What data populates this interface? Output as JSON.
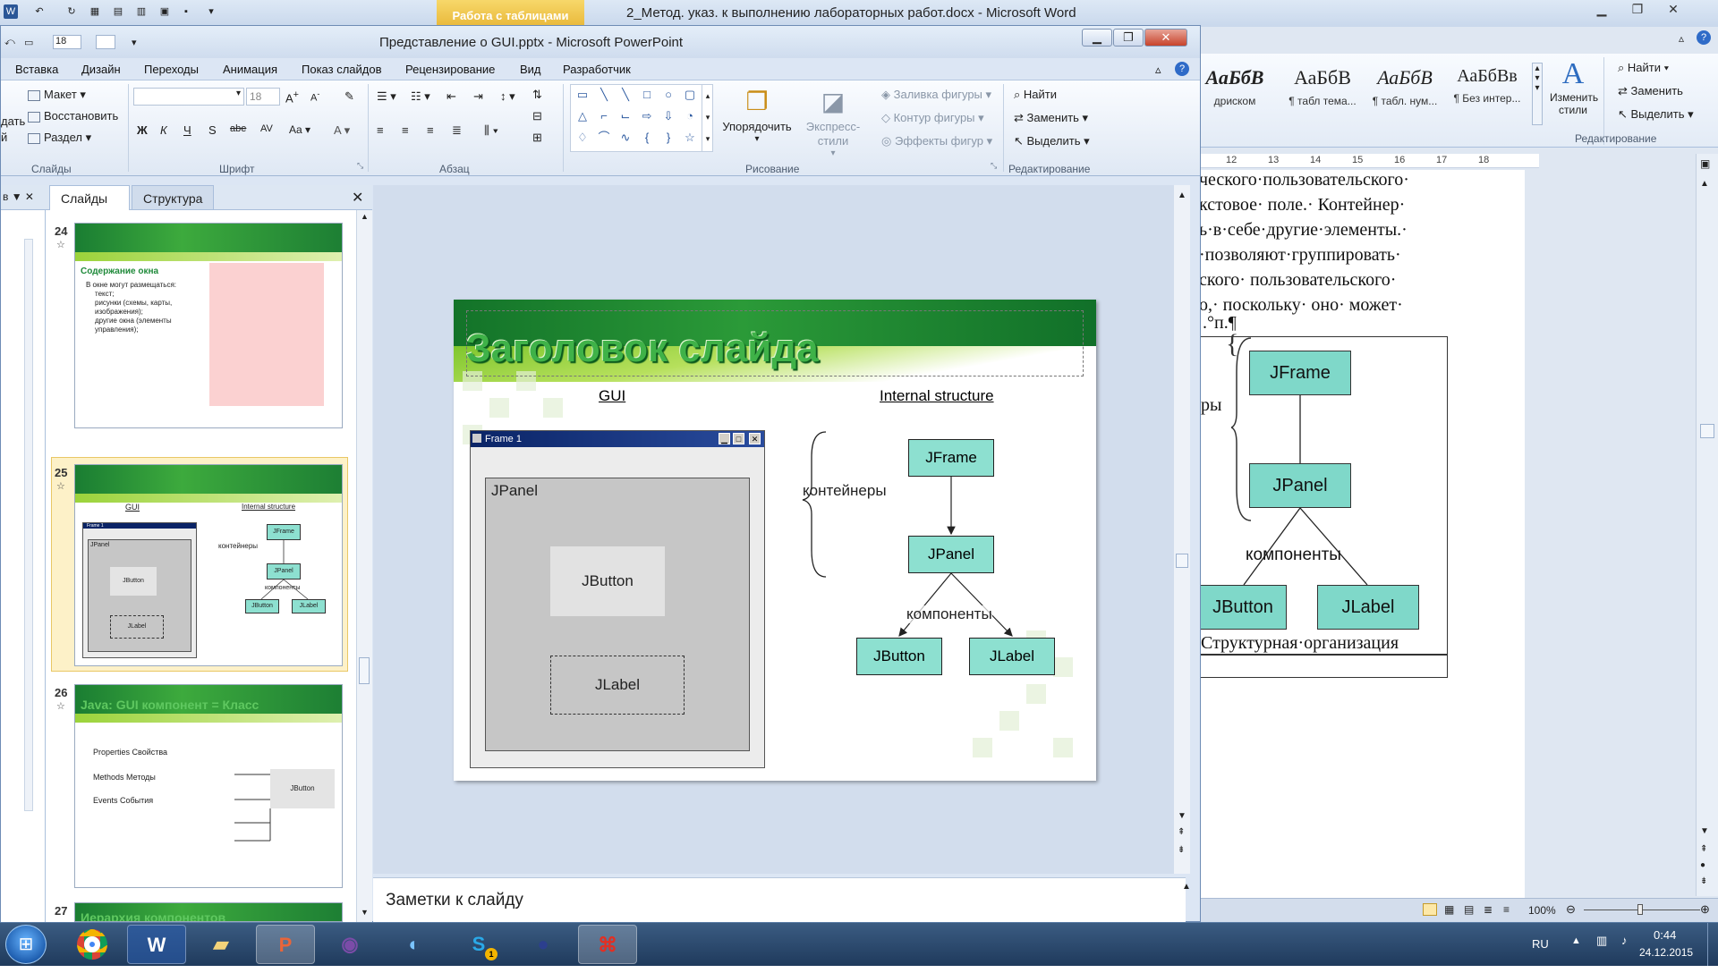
{
  "word": {
    "title": "2_Метод. указ. к выполнению лабораторных работ.docx - Microsoft Word",
    "context_tab": "Работа с таблицами",
    "styles": [
      {
        "sample": "АаБбВ",
        "name": "дриском"
      },
      {
        "sample": "АаБбВ",
        "name": "¶ табл тема..."
      },
      {
        "sample": "АаБбВ",
        "name": "¶ табл. нум..."
      },
      {
        "sample": "АаБбВв",
        "name": "¶ Без интер..."
      }
    ],
    "change_styles": "Изменить стили",
    "find": "Найти",
    "replace": "Заменить",
    "select": "Выделить",
    "editing_group": "Редактирование",
    "ruler": [
      "12",
      "13",
      "14",
      "15",
      "16",
      "17",
      "18"
    ],
    "doc_lines": [
      "ческого·пользовательского·",
      "кстовое· поле.· Контейнер·",
      "ь·в·себе·другие·элементы.·",
      "·позволяют·группировать·",
      "ского· пользовательского·",
      "о,· поскольку· оно· может·",
      ".°п.¶"
    ],
    "diagram": {
      "frame": "JFrame",
      "panel": "JPanel",
      "button": "JButton",
      "label": "JLabel",
      "components": "компоненты",
      "containers_partial": "ры"
    },
    "caption": "Структурная·организация",
    "zoom": "100%"
  },
  "ppt": {
    "title": "Представление о GUI.pptx - Microsoft PowerPoint",
    "font_size": "18",
    "tabs": [
      "Вставка",
      "Дизайн",
      "Переходы",
      "Анимация",
      "Показ слайдов",
      "Рецензирование",
      "Вид",
      "Разработчик"
    ],
    "ribbon": {
      "layout": "Макет",
      "reset": "Восстановить",
      "section": "Раздел",
      "slides_group": "Слайды",
      "font_group": "Шрифт",
      "font_size": "18",
      "para_group": "Абзац",
      "arrange": "Упорядочить",
      "quick_styles": "Экспресс-стили",
      "fill": "Заливка фигуры",
      "outline": "Контур фигуры",
      "effects": "Эффекты фигур",
      "drawing_group": "Рисование",
      "find": "Найти",
      "replace": "Заменить",
      "select": "Выделить",
      "editing_group": "Редактирование",
      "left_cut": [
        "дать",
        "й"
      ]
    },
    "pane_tabs": {
      "slides": "Слайды",
      "outline": "Структура"
    },
    "thumbnails": [
      {
        "num": "24",
        "title": "Содержание окна",
        "bullets": [
          "В окне могут размещаться:",
          "текст;",
          "рисунки (схемы, карты, изображения);",
          "другие окна (элементы управления);"
        ]
      },
      {
        "num": "25",
        "gui": "GUI",
        "internal": "Internal structure",
        "containers": "контейнеры",
        "frame": "JFrame",
        "panel": "JPanel",
        "components": "компоненты",
        "button": "JButton",
        "label": "JLabel",
        "frame_title": "Frame 1",
        "jpanel": "JPanel",
        "jbutton": "JButton",
        "jlabel": "JLabel"
      },
      {
        "num": "26",
        "title": "Java:  GUI компонент = Класс",
        "items": [
          "Properties Свойства",
          "Methods Методы",
          "Events События"
        ],
        "button": "JButton"
      },
      {
        "num": "27",
        "title": "Иерархия  компонентов"
      }
    ],
    "slide": {
      "title": "Заголовок слайда",
      "gui_label": "GUI",
      "internal_label": "Internal structure",
      "frame_title": "Frame 1",
      "jpanel": "JPanel",
      "jbutton": "JButton",
      "jlabel": "JLabel",
      "containers": "контейнеры",
      "components": "компоненты",
      "box_frame": "JFrame",
      "box_panel": "JPanel",
      "box_button": "JButton",
      "box_label": "JLabel"
    },
    "notes": "Заметки к слайду"
  },
  "taskbar": {
    "lang": "RU",
    "time": "0:44",
    "date": "24.12.2015",
    "apps": [
      "chrome-icon",
      "word-icon",
      "explorer-icon",
      "powerpoint-icon",
      "eclipse-icon",
      "media-icon",
      "skype-icon",
      "eclipse-icon",
      "acrobat-icon"
    ],
    "skype_badge": "1"
  },
  "colors": {
    "diagram_box": "#8de0d0",
    "slide_green": "#2b9a38",
    "title_bar": "#0a2466"
  }
}
